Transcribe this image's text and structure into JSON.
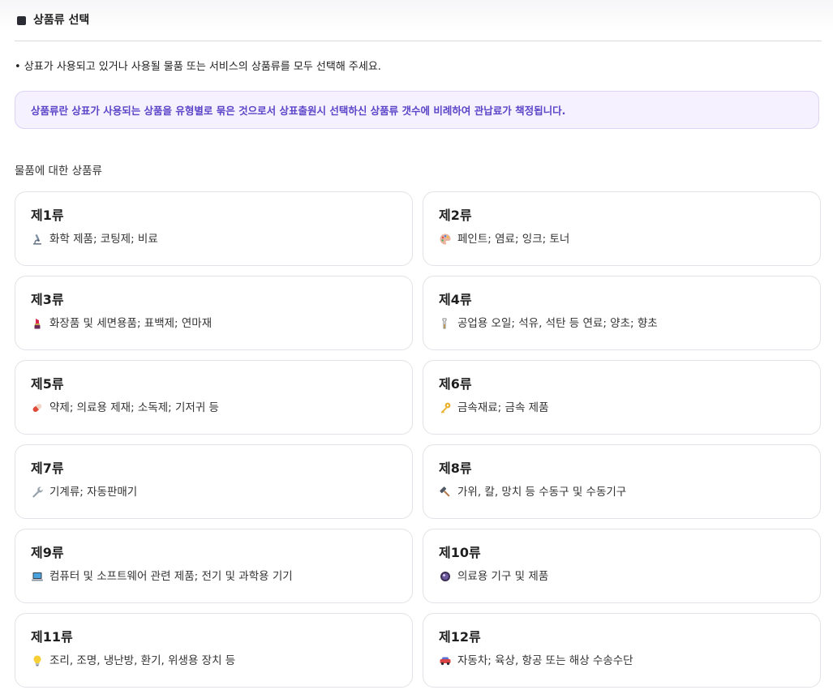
{
  "header": {
    "title": "상품류 선택"
  },
  "instruction": "• 상표가 사용되고 있거나 사용될 물품 또는 서비스의 상품류를 모두 선택해 주세요.",
  "notice": "상품류란 상표가 사용되는 상품을 유형별로 묶은 것으로서 상표출원시 선택하신 상품류 갯수에 비례하여 관납료가 책정됩니다.",
  "goods_section": {
    "heading": "물품에 대한 상품류",
    "classes": [
      {
        "label": "제1류",
        "icon": "microscope-icon",
        "description": "화학 제품; 코팅제; 비료"
      },
      {
        "label": "제2류",
        "icon": "palette-icon",
        "description": "페인트; 염료; 잉크; 토너"
      },
      {
        "label": "제3류",
        "icon": "lipstick-icon",
        "description": "화장품 및 세면용품; 표백제; 연마재"
      },
      {
        "label": "제4류",
        "icon": "oil-drop-icon",
        "description": "공업용 오일; 석유, 석탄 등 연료; 양초; 향초"
      },
      {
        "label": "제5류",
        "icon": "pill-icon",
        "description": "약제; 의료용 제재; 소독제; 기저귀 등"
      },
      {
        "label": "제6류",
        "icon": "key-icon",
        "description": "금속재료; 금속 제품"
      },
      {
        "label": "제7류",
        "icon": "wrench-icon",
        "description": "기계류; 자동판매기"
      },
      {
        "label": "제8류",
        "icon": "hammer-icon",
        "description": "가위, 칼, 망치 등 수동구 및 수동기구"
      },
      {
        "label": "제9류",
        "icon": "laptop-icon",
        "description": "컴퓨터 및 소프트웨어 관련 제품; 전기 및 과학용 기기"
      },
      {
        "label": "제10류",
        "icon": "medical-device-icon",
        "description": "의료용 기구 및 제품"
      },
      {
        "label": "제11류",
        "icon": "light-bulb-icon",
        "description": "조리, 조명, 냉난방, 환기, 위생용 장치 등"
      },
      {
        "label": "제12류",
        "icon": "car-icon",
        "description": "자동차; 육상, 항공 또는 해상 수송수단"
      }
    ]
  }
}
